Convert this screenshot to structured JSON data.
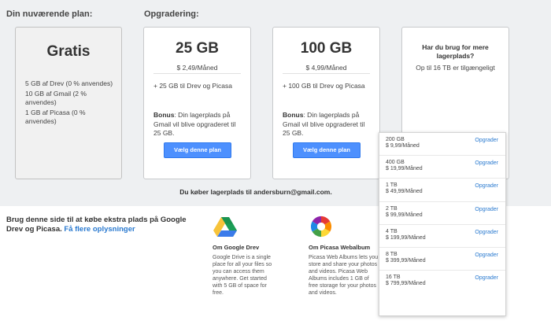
{
  "labels": {
    "current_plan": "Din nuværende plan:",
    "upgrade": "Opgradering:"
  },
  "current": {
    "title": "Gratis",
    "items": [
      "5 GB af Drev (0 % anvendes)",
      "10 GB af Gmail (2 % anvendes)",
      "1 GB af Picasa (0 % anvendes)"
    ]
  },
  "plans": [
    {
      "title": "25 GB",
      "price": "$ 2,49/Måned",
      "line": "+ 25 GB til Drev og Picasa",
      "bonus_label": "Bonus",
      "bonus_text": ": Din lagerplads på Gmail vil blive opgraderet til 25 GB.",
      "button": "Vælg denne plan"
    },
    {
      "title": "100 GB",
      "price": "$ 4,99/Måned",
      "line": "+ 100 GB til Drev og Picasa",
      "bonus_label": "Bonus",
      "bonus_text": ": Din lagerplads på Gmail vil blive opgraderet til 25 GB.",
      "button": "Vælg denne plan"
    }
  ],
  "more": {
    "title": "Har du brug for mere lagerplads?",
    "subtitle": "Op til 16 TB er tilgængeligt"
  },
  "buying_text": "Du køber lagerplads til andersburn@gmail.com.",
  "info": {
    "text": "Brug denne side til at købe ekstra plads på Google Drev og Picasa.",
    "link": "Få flere oplysninger"
  },
  "about_drive": {
    "title": "Om Google Drev",
    "text": "Google Drive is a single place for all your files so you can access them anywhere. Get started with 5 GB of space for free."
  },
  "about_picasa": {
    "title": "Om Picasa Webalbum",
    "text": "Picasa Web Albums lets you store and share your photos and videos. Picasa Web Albums includes 1 GB of free storage for your photos and videos."
  },
  "dropdown": [
    {
      "size": "200 GB",
      "price": "$ 9,99/Måned",
      "link": "Opgrader"
    },
    {
      "size": "400 GB",
      "price": "$ 19,99/Måned",
      "link": "Opgrader"
    },
    {
      "size": "1 TB",
      "price": "$ 49,99/Måned",
      "link": "Opgrader"
    },
    {
      "size": "2 TB",
      "price": "$ 99,99/Måned",
      "link": "Opgrader"
    },
    {
      "size": "4 TB",
      "price": "$ 199,99/Måned",
      "link": "Opgrader"
    },
    {
      "size": "8 TB",
      "price": "$ 399,99/Måned",
      "link": "Opgrader"
    },
    {
      "size": "16 TB",
      "price": "$ 799,99/Måned",
      "link": "Opgrader"
    }
  ],
  "colors": {
    "accent": "#4d90fe",
    "link": "#2a7ad0",
    "background": "#eef0f2"
  }
}
